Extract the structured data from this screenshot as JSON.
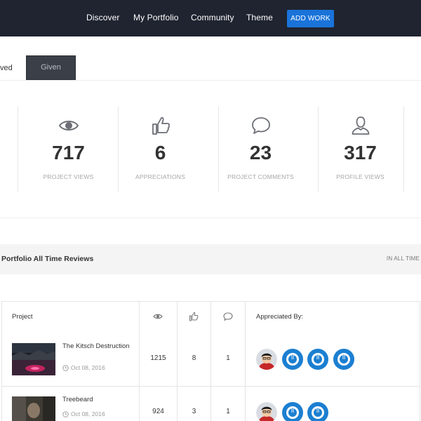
{
  "nav": {
    "links": [
      "Discover",
      "My Portfolio",
      "Community",
      "Theme"
    ],
    "add_work": "ADD WORK"
  },
  "tabs": {
    "received": "ved",
    "given": "Given"
  },
  "stats": [
    {
      "icon": "eye-icon",
      "value": "717",
      "label": "PROJECT VIEWS"
    },
    {
      "icon": "thumbs-up-icon",
      "value": "6",
      "label": "APPRECIATIONS"
    },
    {
      "icon": "speech-bubble-icon",
      "value": "23",
      "label": "PROJECT COMMENTS"
    },
    {
      "icon": "user-icon",
      "value": "317",
      "label": "PROFILE VIEWS"
    }
  ],
  "section": {
    "title": "Portfolio All Time Reviews",
    "range": "IN ALL TIME"
  },
  "table": {
    "headers": {
      "project": "Project",
      "views_icon": "eye-icon",
      "appreciations_icon": "thumbs-up-icon",
      "comments_icon": "speech-bubble-icon",
      "appreciated_by": "Appreciated By:"
    },
    "rows": [
      {
        "title": "The Kitsch Destruction",
        "date": "Oct 08, 2016",
        "views": "1215",
        "appreciations": "8",
        "comments": "1",
        "appreciators": [
          "cartoon-avatar",
          "power-icon",
          "power-icon",
          "power-icon"
        ]
      },
      {
        "title": "Treebeard",
        "date": "Oct 08, 2016",
        "views": "924",
        "appreciations": "3",
        "comments": "1",
        "appreciators": [
          "cartoon-avatar",
          "power-icon",
          "power-icon"
        ]
      }
    ]
  },
  "colors": {
    "nav_bg": "#1f2430",
    "accent": "#1a73d9",
    "power_icon": "#1b7fd1"
  }
}
